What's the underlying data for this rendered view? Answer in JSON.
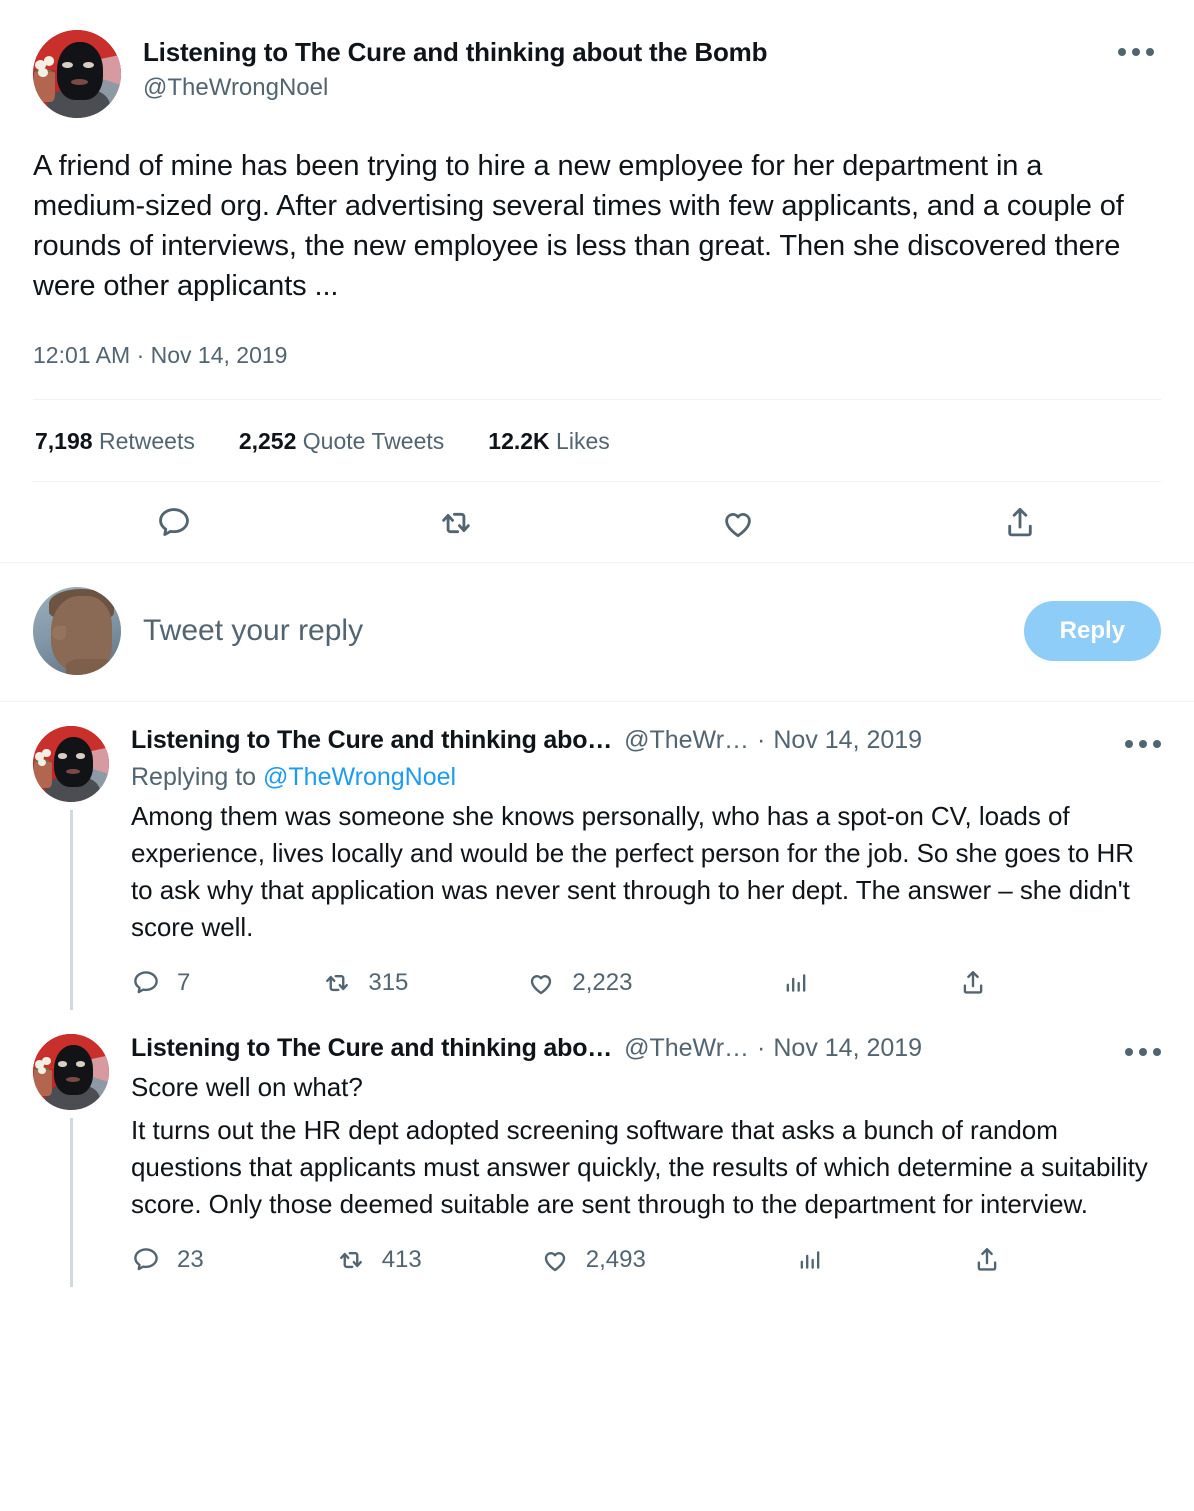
{
  "primary_tweet": {
    "display_name": "Listening to The Cure and thinking about the Bomb",
    "handle": "@TheWrongNoel",
    "body": "A friend of mine has been trying to hire a new employee for her department in a medium-sized org. After advertising several times with few applicants, and a couple of rounds of interviews, the new employee is less than great. Then she discovered there were other applicants ...",
    "timestamp": "12:01 AM · Nov 14, 2019",
    "stats": {
      "retweets_count": "7,198",
      "retweets_label": "Retweets",
      "quotes_count": "2,252",
      "quotes_label": "Quote Tweets",
      "likes_count": "12.2K",
      "likes_label": "Likes"
    },
    "avatar_alt": "person-in-black-balaclava-red-background"
  },
  "composer": {
    "placeholder": "Tweet your reply",
    "reply_button_label": "Reply",
    "reply_button_color": "#8ecdf8",
    "avatar_alt": "man-face-profile-photo"
  },
  "replies": [
    {
      "display_name": "Listening to The Cure and thinking abo…",
      "handle": "@TheWr…",
      "separator": "·",
      "date": "Nov 14, 2019",
      "replying_to_prefix": "Replying to",
      "replying_to_mention": "@TheWrongNoel",
      "body": "Among them was someone she knows personally, who has a spot-on CV, loads of experience, lives locally and would be the perfect person for the job. So she goes to HR to ask why that application was never sent through to her dept. The answer – she didn't score well.",
      "reply_count": "7",
      "retweet_count": "315",
      "like_count": "2,223"
    },
    {
      "display_name": "Listening to The Cure and thinking abo…",
      "handle": "@TheWr…",
      "separator": "·",
      "date": "Nov 14, 2019",
      "body_line1": "Score well on what?",
      "body": "It turns out the HR dept adopted screening software that asks a bunch of random questions that applicants must answer quickly, the results of which determine a suitability score. Only those deemed suitable are sent through to the department for interview.",
      "reply_count": "23",
      "retweet_count": "413",
      "like_count": "2,493"
    }
  ],
  "colors": {
    "text_primary": "#0f1419",
    "text_secondary": "#536471",
    "link": "#1d9bf0",
    "divider": "#eff3f4",
    "thread_line": "#cfd9de"
  },
  "icons": {
    "reply": "reply-icon",
    "retweet": "retweet-icon",
    "like": "like-icon",
    "share": "share-icon",
    "analytics": "analytics-icon",
    "more": "more-options-icon"
  }
}
